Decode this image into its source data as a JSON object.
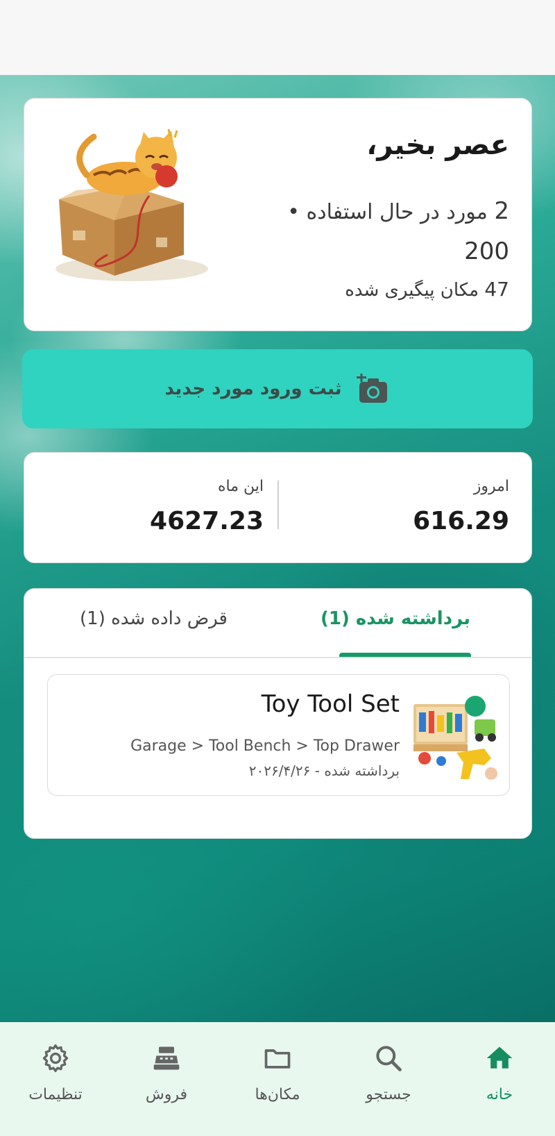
{
  "greeting": {
    "title": "عصر بخیر،",
    "items_in_use_count": "2",
    "items_in_use_text": "مورد در حال استفاده •",
    "total_value": "200",
    "locations_count": "47",
    "locations_text": "مکان پیگیری شده"
  },
  "add_entry": {
    "label": "ثبت ورود مورد جدید"
  },
  "stats": {
    "today_label": "امروز",
    "today_value": "616.29",
    "month_label": "این ماه",
    "month_value": "4627.23"
  },
  "tabs": {
    "checked_out": "برداشته شده (1)",
    "lent": "قرض داده شده (1)"
  },
  "item": {
    "name": "Toy Tool Set",
    "path": "Garage > Tool Bench > Top Drawer",
    "status": "برداشته شده - ۲۰۲۶/۴/۲۶"
  },
  "nav": {
    "home": "خانه",
    "search": "جستجو",
    "locations": "مکان‌ها",
    "sales": "فروش",
    "settings": "تنظیمات"
  },
  "colors": {
    "accent": "#1a9464",
    "add_button": "#2fd3c0",
    "nav_bg": "#e8f8ef"
  }
}
